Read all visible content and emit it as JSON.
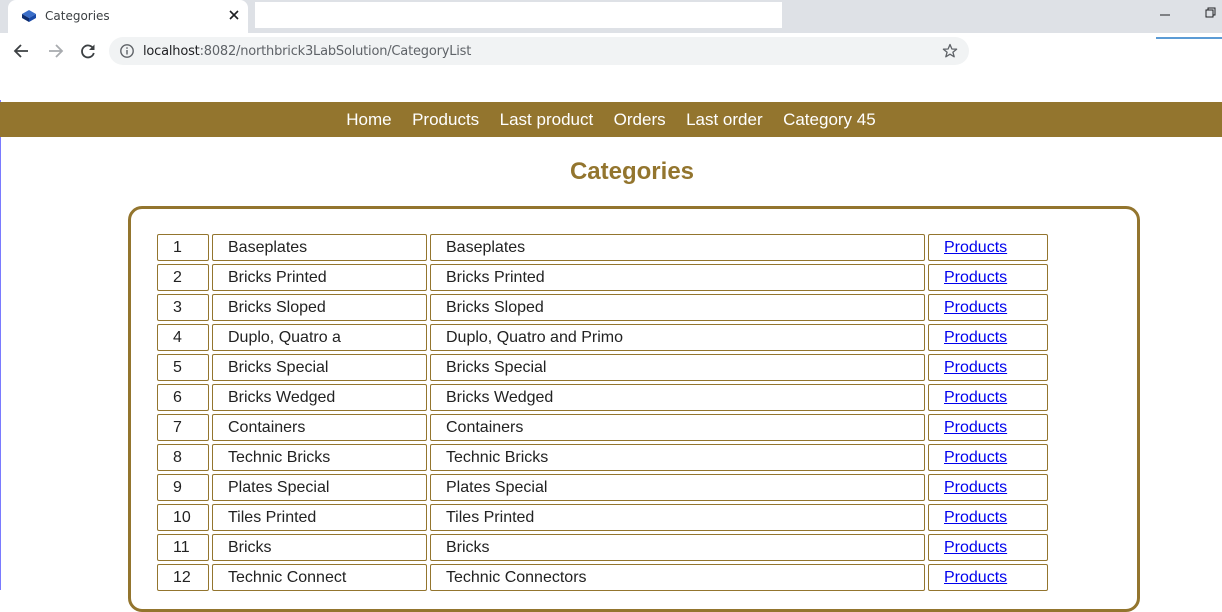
{
  "browser": {
    "tab_title": "Categories",
    "url_host": "localhost",
    "url_rest": ":8082/northbrick3LabSolution/CategoryList"
  },
  "colors": {
    "brand": "#93752e",
    "link": "#0000ee"
  },
  "nav": {
    "items": [
      "Home",
      "Products",
      "Last product",
      "Orders",
      "Last order",
      "Category 45"
    ]
  },
  "page": {
    "title": "Categories"
  },
  "categories": [
    {
      "id": "1",
      "name": "Baseplates",
      "description": "Baseplates",
      "link": "Products"
    },
    {
      "id": "2",
      "name": "Bricks Printed",
      "description": "Bricks Printed",
      "link": "Products"
    },
    {
      "id": "3",
      "name": "Bricks Sloped",
      "description": "Bricks Sloped",
      "link": "Products"
    },
    {
      "id": "4",
      "name": "Duplo, Quatro a",
      "description": "Duplo, Quatro and Primo",
      "link": "Products"
    },
    {
      "id": "5",
      "name": "Bricks Special",
      "description": "Bricks Special",
      "link": "Products"
    },
    {
      "id": "6",
      "name": "Bricks Wedged",
      "description": "Bricks Wedged",
      "link": "Products"
    },
    {
      "id": "7",
      "name": "Containers",
      "description": "Containers",
      "link": "Products"
    },
    {
      "id": "8",
      "name": "Technic Bricks",
      "description": "Technic Bricks",
      "link": "Products"
    },
    {
      "id": "9",
      "name": "Plates Special",
      "description": "Plates Special",
      "link": "Products"
    },
    {
      "id": "10",
      "name": "Tiles Printed",
      "description": "Tiles Printed",
      "link": "Products"
    },
    {
      "id": "11",
      "name": "Bricks",
      "description": "Bricks",
      "link": "Products"
    },
    {
      "id": "12",
      "name": "Technic Connect",
      "description": "Technic Connectors",
      "link": "Products"
    }
  ]
}
